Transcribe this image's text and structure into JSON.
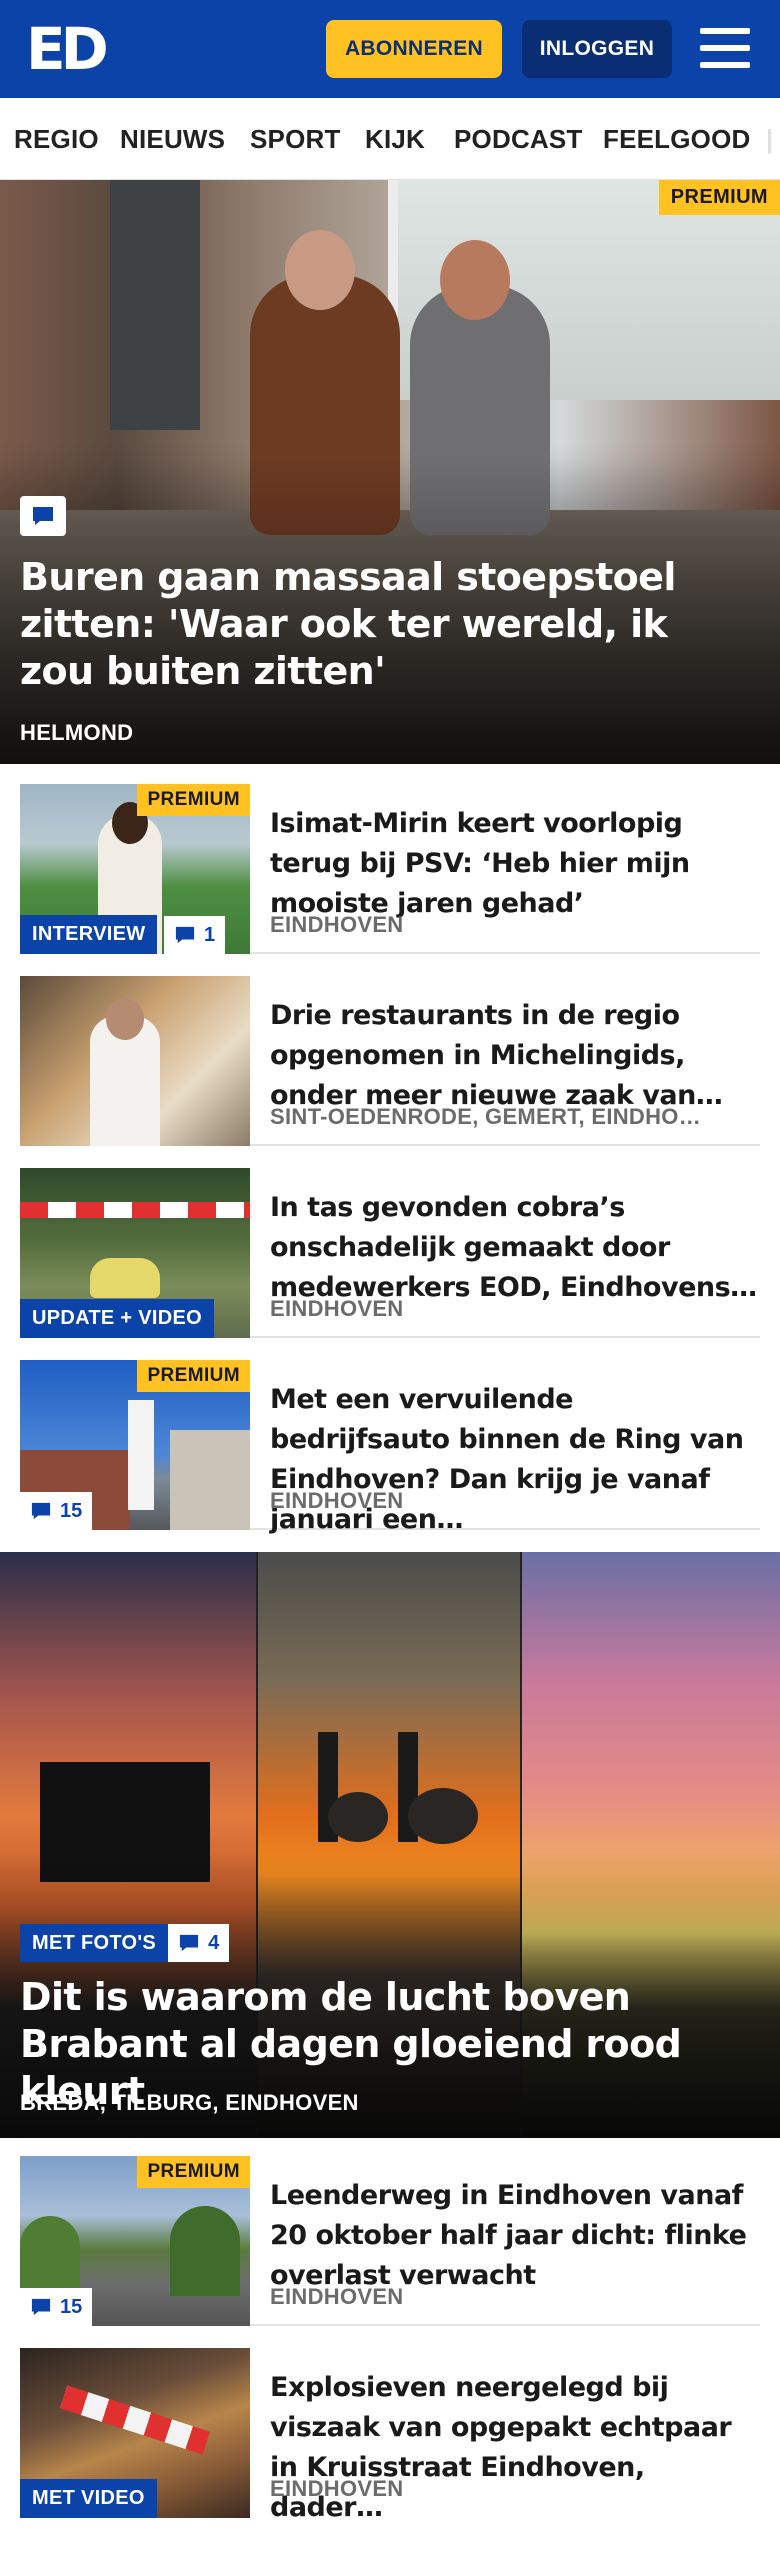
{
  "header": {
    "logo_text": "ED",
    "subscribe_label": "ABONNEREN",
    "login_label": "INLOGGEN",
    "menu_icon": "hamburger-menu-icon",
    "brand_color": "#0b43a8",
    "accent_color": "#ffc222"
  },
  "nav": {
    "items": [
      "REGIO",
      "NIEUWS",
      "SPORT",
      "KIJK",
      "PODCAST",
      "FEELGOOD"
    ]
  },
  "hero": {
    "premium_label": "PREMIUM",
    "comment_icon": "comment-bubble-icon",
    "title": "Buren gaan massaal stoepstoel zitten: 'Waar ook ter wereld, ik zou buiten zitten'",
    "location": "HELMOND"
  },
  "articles": [
    {
      "title": "Isimat-Mirin keert voorlopig terug bij PSV: ‘Heb hier mijn mooiste jaren gehad’",
      "location": "EINDHOVEN",
      "premium_label": "PREMIUM",
      "tag": "INTERVIEW",
      "comments": "1"
    },
    {
      "title": "Drie restaurants in de regio opgenomen in Michelingids, onder meer nieuwe zaak van…",
      "location": "SINT-OEDENRODE, GEMERT, EINDHO…"
    },
    {
      "title": "In tas gevonden cobra’s onschadelijk gemaakt door medewerkers EOD, Eindhovens…",
      "location": "EINDHOVEN",
      "tag": "UPDATE + VIDEO"
    },
    {
      "title": "Met een vervuilende bedrijfsauto binnen de Ring van Eindhoven? Dan krijg je vanaf januari een…",
      "location": "EINDHOVEN",
      "premium_label": "PREMIUM",
      "comments": "15"
    }
  ],
  "feature": {
    "tag": "MET FOTO'S",
    "comments": "4",
    "title": "Dit is waarom de lucht boven Brabant al dagen gloeiend rood kleurt",
    "location": "BREDA, TILBURG, EINDHOVEN"
  },
  "articles2": [
    {
      "title": "Leenderweg in Eindhoven vanaf 20 oktober half jaar dicht: flinke overlast verwacht",
      "location": "EINDHOVEN",
      "premium_label": "PREMIUM",
      "comments": "15"
    },
    {
      "title": "Explosieven neergelegd bij viszaak van opgepakt echtpaar in Kruisstraat Eindhoven, dader…",
      "location": "EINDHOVEN",
      "tag": "MET VIDEO"
    }
  ]
}
